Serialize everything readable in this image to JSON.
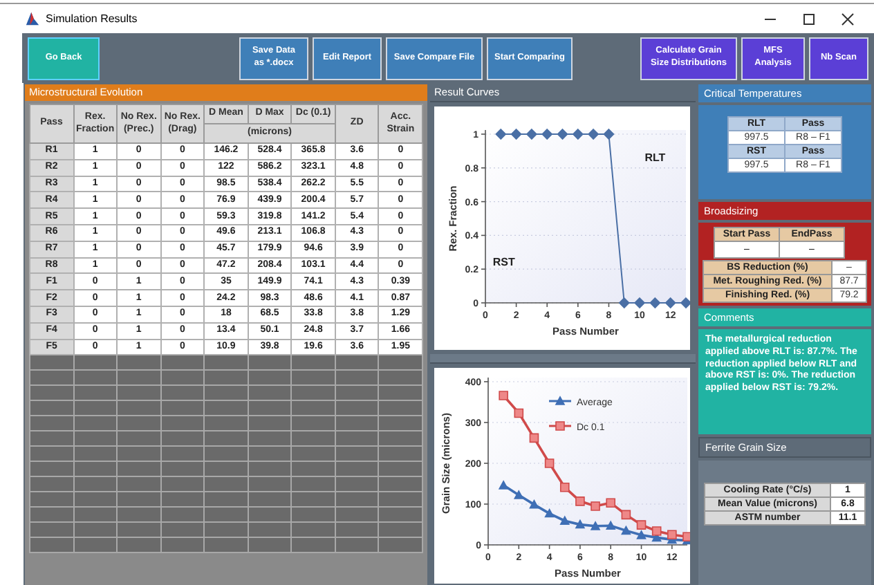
{
  "window": {
    "title": "Simulation Results"
  },
  "toolbar": {
    "buttons": [
      {
        "label": "Go Back",
        "kind": "back"
      },
      {
        "label": "Save Data as *.docx",
        "kind": "file"
      },
      {
        "label": "Edit Report",
        "kind": "file"
      },
      {
        "label": "Save Compare File",
        "kind": "file"
      },
      {
        "label": "Start Comparing",
        "kind": "file"
      },
      {
        "label": "Calculate Grain Size Distributions",
        "kind": "analysis"
      },
      {
        "label": "MFS Analysis",
        "kind": "analysis"
      },
      {
        "label": "Nb Scan",
        "kind": "analysis"
      }
    ]
  },
  "microstructure": {
    "title": "Microstructural Evolution",
    "unit": "(microns)",
    "columns": [
      {
        "label": "Pass",
        "grouped": false
      },
      {
        "label": "Rex. Fraction",
        "grouped": false
      },
      {
        "label": "No Rex. (Prec.)",
        "grouped": false
      },
      {
        "label": "No Rex. (Drag)",
        "grouped": false
      },
      {
        "label": "D Mean",
        "grouped": true
      },
      {
        "label": "D Max",
        "grouped": true
      },
      {
        "label": "Dc (0.1)",
        "grouped": true
      },
      {
        "label": "ZD",
        "grouped": false
      },
      {
        "label": "Acc. Strain",
        "grouped": false
      }
    ],
    "rows": [
      {
        "cells": [
          "R1",
          "1",
          "0",
          "0",
          "146.2",
          "528.4",
          "365.8",
          "3.6",
          "0"
        ]
      },
      {
        "cells": [
          "R2",
          "1",
          "0",
          "0",
          "122",
          "586.2",
          "323.1",
          "4.8",
          "0"
        ]
      },
      {
        "cells": [
          "R3",
          "1",
          "0",
          "0",
          "98.5",
          "538.4",
          "262.2",
          "5.5",
          "0"
        ]
      },
      {
        "cells": [
          "R4",
          "1",
          "0",
          "0",
          "76.9",
          "439.9",
          "200.4",
          "5.7",
          "0"
        ]
      },
      {
        "cells": [
          "R5",
          "1",
          "0",
          "0",
          "59.3",
          "319.8",
          "141.2",
          "5.4",
          "0"
        ]
      },
      {
        "cells": [
          "R6",
          "1",
          "0",
          "0",
          "49.6",
          "213.1",
          "106.8",
          "4.3",
          "0"
        ]
      },
      {
        "cells": [
          "R7",
          "1",
          "0",
          "0",
          "45.7",
          "179.9",
          "94.6",
          "3.9",
          "0"
        ]
      },
      {
        "cells": [
          "R8",
          "1",
          "0",
          "0",
          "47.2",
          "208.4",
          "103.1",
          "4.4",
          "0"
        ]
      },
      {
        "cells": [
          "F1",
          "0",
          "1",
          "0",
          "35",
          "149.9",
          "74.1",
          "4.3",
          "0.39"
        ]
      },
      {
        "cells": [
          "F2",
          "0",
          "1",
          "0",
          "24.2",
          "98.3",
          "48.6",
          "4.1",
          "0.87"
        ]
      },
      {
        "cells": [
          "F3",
          "0",
          "1",
          "0",
          "18",
          "68.5",
          "33.8",
          "3.8",
          "1.29"
        ]
      },
      {
        "cells": [
          "F4",
          "0",
          "1",
          "0",
          "13.4",
          "50.1",
          "24.8",
          "3.7",
          "1.66"
        ]
      },
      {
        "cells": [
          "F5",
          "0",
          "1",
          "0",
          "10.9",
          "39.8",
          "19.6",
          "3.6",
          "1.95"
        ]
      }
    ]
  },
  "result_curves": {
    "title": "Result Curves",
    "chart_data": [
      {
        "type": "line",
        "xlabel": "Pass Number",
        "ylabel": "Rex. Fraction",
        "x": [
          1,
          2,
          3,
          4,
          5,
          6,
          7,
          8,
          9,
          10,
          11,
          12,
          13
        ],
        "series": [
          {
            "color": "#4a6fa5",
            "marker": "diamond",
            "values": [
              1,
              1,
              1,
              1,
              1,
              1,
              1,
              1,
              0,
              0,
              0,
              0,
              0
            ]
          }
        ],
        "xlim": [
          0,
          13
        ],
        "ylim": [
          0,
          1
        ],
        "xticks": [
          0,
          2,
          4,
          6,
          8,
          10,
          12
        ],
        "yticks": [
          0,
          0.2,
          0.4,
          0.6,
          0.8,
          1
        ],
        "grid": true,
        "annotations": [
          "RLT",
          "RST"
        ]
      },
      {
        "type": "line",
        "xlabel": "Pass Number",
        "ylabel": "Grain Size (microns)",
        "x": [
          1,
          2,
          3,
          4,
          5,
          6,
          7,
          8,
          9,
          10,
          11,
          12,
          13
        ],
        "series": [
          {
            "name": "Average",
            "color": "#3f6fb5",
            "marker": "triangle",
            "values": [
              146,
              122,
              99,
              77,
              59,
              50,
              46,
              47,
              35,
              24,
              18,
              13,
              11
            ]
          },
          {
            "name": "Dc 0.1",
            "color": "#d04a4a",
            "marker": "square",
            "values": [
              366,
              323,
              262,
              200,
              141,
              107,
              95,
              103,
              74,
              49,
              34,
              25,
              20
            ]
          }
        ],
        "xlim": [
          0,
          13
        ],
        "ylim": [
          0,
          400
        ],
        "xticks": [
          0,
          2,
          4,
          6,
          8,
          10,
          12
        ],
        "yticks": [
          0,
          100,
          200,
          300,
          400
        ],
        "grid": true,
        "legend": true
      }
    ]
  },
  "critical_temperatures": {
    "title": "Critical Temperatures",
    "tables": [
      {
        "headers": [
          "RLT",
          "Pass"
        ],
        "values": [
          "997.5",
          "R8 – F1"
        ]
      },
      {
        "headers": [
          "RST",
          "Pass"
        ],
        "values": [
          "997.5",
          "R8 – F1"
        ]
      }
    ]
  },
  "broadsizing": {
    "title": "Broadsizing",
    "pass_headers": [
      "Start Pass",
      "EndPass"
    ],
    "pass_values": [
      "–",
      "–"
    ],
    "rows": [
      {
        "label": "BS Reduction (%)",
        "value": "–"
      },
      {
        "label": "Met. Roughing Red. (%)",
        "value": "87.7"
      },
      {
        "label": "Finishing Red. (%)",
        "value": "79.2"
      }
    ]
  },
  "comments": {
    "title": "Comments",
    "text": "The metallurgical reduction applied above RLT is: 87.7%. The reduction applied below RLT and above RST is: 0%. The reduction applied below RST is: 79.2%."
  },
  "ferrite_grain_size": {
    "title": "Ferrite Grain Size",
    "rows": [
      {
        "label": "Cooling Rate (°C/s)",
        "value": "1"
      },
      {
        "label": "Mean Value (microns)",
        "value": "6.8"
      },
      {
        "label": "ASTM number",
        "value": "11.1"
      }
    ]
  }
}
